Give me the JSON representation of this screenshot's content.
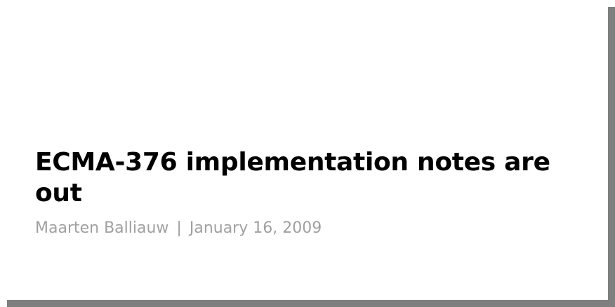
{
  "post": {
    "title": "ECMA-376 implementation notes are out",
    "author": "Maarten Balliauw",
    "separator": "|",
    "date": "January 16, 2009"
  },
  "colors": {
    "background": "#ffffff",
    "shadow": "#7f7f7f",
    "title": "#000000",
    "meta": "#a0a0a0"
  }
}
